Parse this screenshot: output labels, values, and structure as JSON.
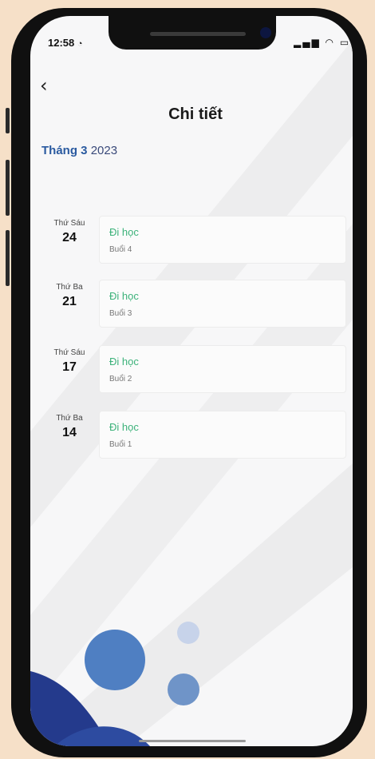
{
  "status_bar": {
    "time": "12:58",
    "clock_icon": "alarm-icon",
    "signal_icon": "signal-icon",
    "wifi_icon": "wifi-icon",
    "battery_icon": "battery-icon"
  },
  "header": {
    "back_icon": "chevron-left-icon",
    "title": "Chi tiết"
  },
  "month": {
    "label": "Tháng 3",
    "year": "2023"
  },
  "entries": [
    {
      "weekday": "Thứ Sáu",
      "day": "24",
      "status": "Đi học",
      "session": "Buổi 4"
    },
    {
      "weekday": "Thứ Ba",
      "day": "21",
      "status": "Đi học",
      "session": "Buổi 3"
    },
    {
      "weekday": "Thứ Sáu",
      "day": "17",
      "status": "Đi học",
      "session": "Buổi 2"
    },
    {
      "weekday": "Thứ Ba",
      "day": "14",
      "status": "Đi học",
      "session": "Buổi 1"
    }
  ],
  "colors": {
    "accent_blue": "#2a5aa0",
    "status_green": "#3cb27a",
    "background": "#f7f7f8"
  }
}
